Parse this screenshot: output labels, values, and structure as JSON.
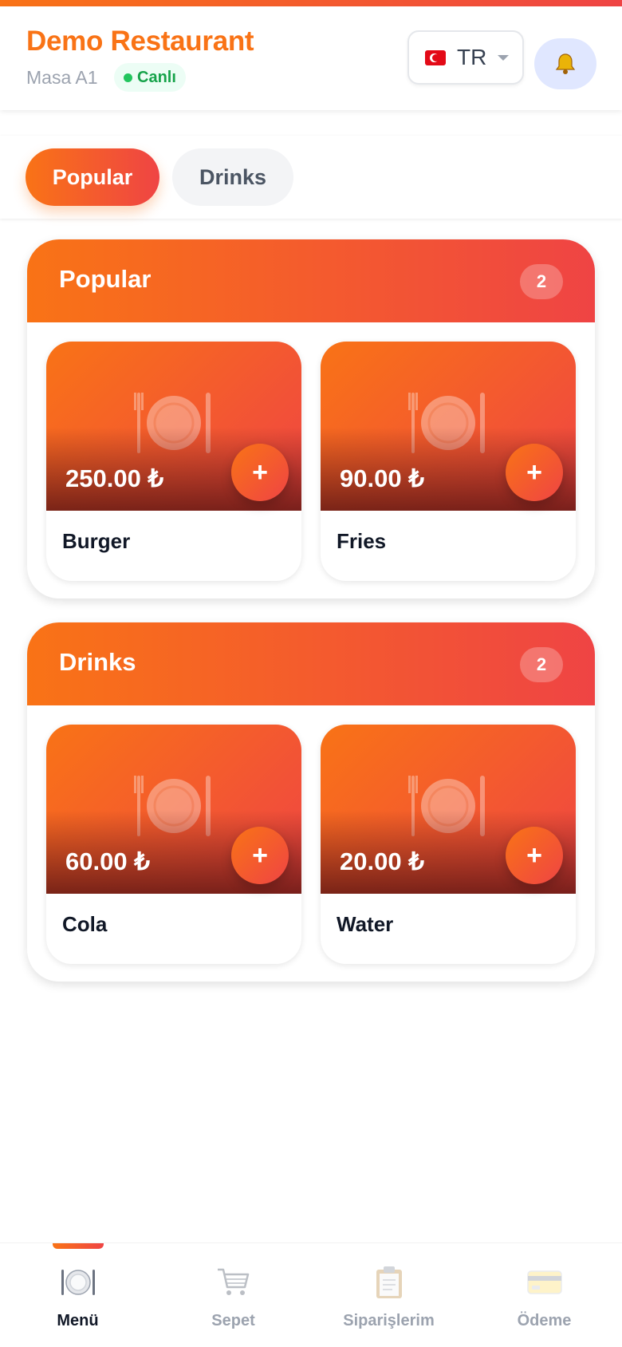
{
  "header": {
    "restaurant_name": "Demo Restaurant",
    "table_label": "Masa A1",
    "live_status": "Canlı",
    "language_code": "TR"
  },
  "tabs": [
    {
      "label": "Popular",
      "active": true
    },
    {
      "label": "Drinks",
      "active": false
    }
  ],
  "currency_symbol": "₺",
  "sections": [
    {
      "title": "Popular",
      "count": "2",
      "items": [
        {
          "name": "Burger",
          "price": "250.00 ₺"
        },
        {
          "name": "Fries",
          "price": "90.00 ₺"
        }
      ]
    },
    {
      "title": "Drinks",
      "count": "2",
      "items": [
        {
          "name": "Cola",
          "price": "60.00 ₺"
        },
        {
          "name": "Water",
          "price": "20.00 ₺"
        }
      ]
    }
  ],
  "add_label": "+",
  "bottom_nav": [
    {
      "label": "Menü",
      "icon": "plate-icon",
      "active": true
    },
    {
      "label": "Sepet",
      "icon": "cart-icon",
      "active": false
    },
    {
      "label": "Siparişlerim",
      "icon": "clipboard-icon",
      "active": false
    },
    {
      "label": "Ödeme",
      "icon": "credit-card-icon",
      "active": false
    }
  ],
  "colors": {
    "accent_start": "#f97316",
    "accent_end": "#ef4444",
    "live_green": "#22c55e"
  }
}
